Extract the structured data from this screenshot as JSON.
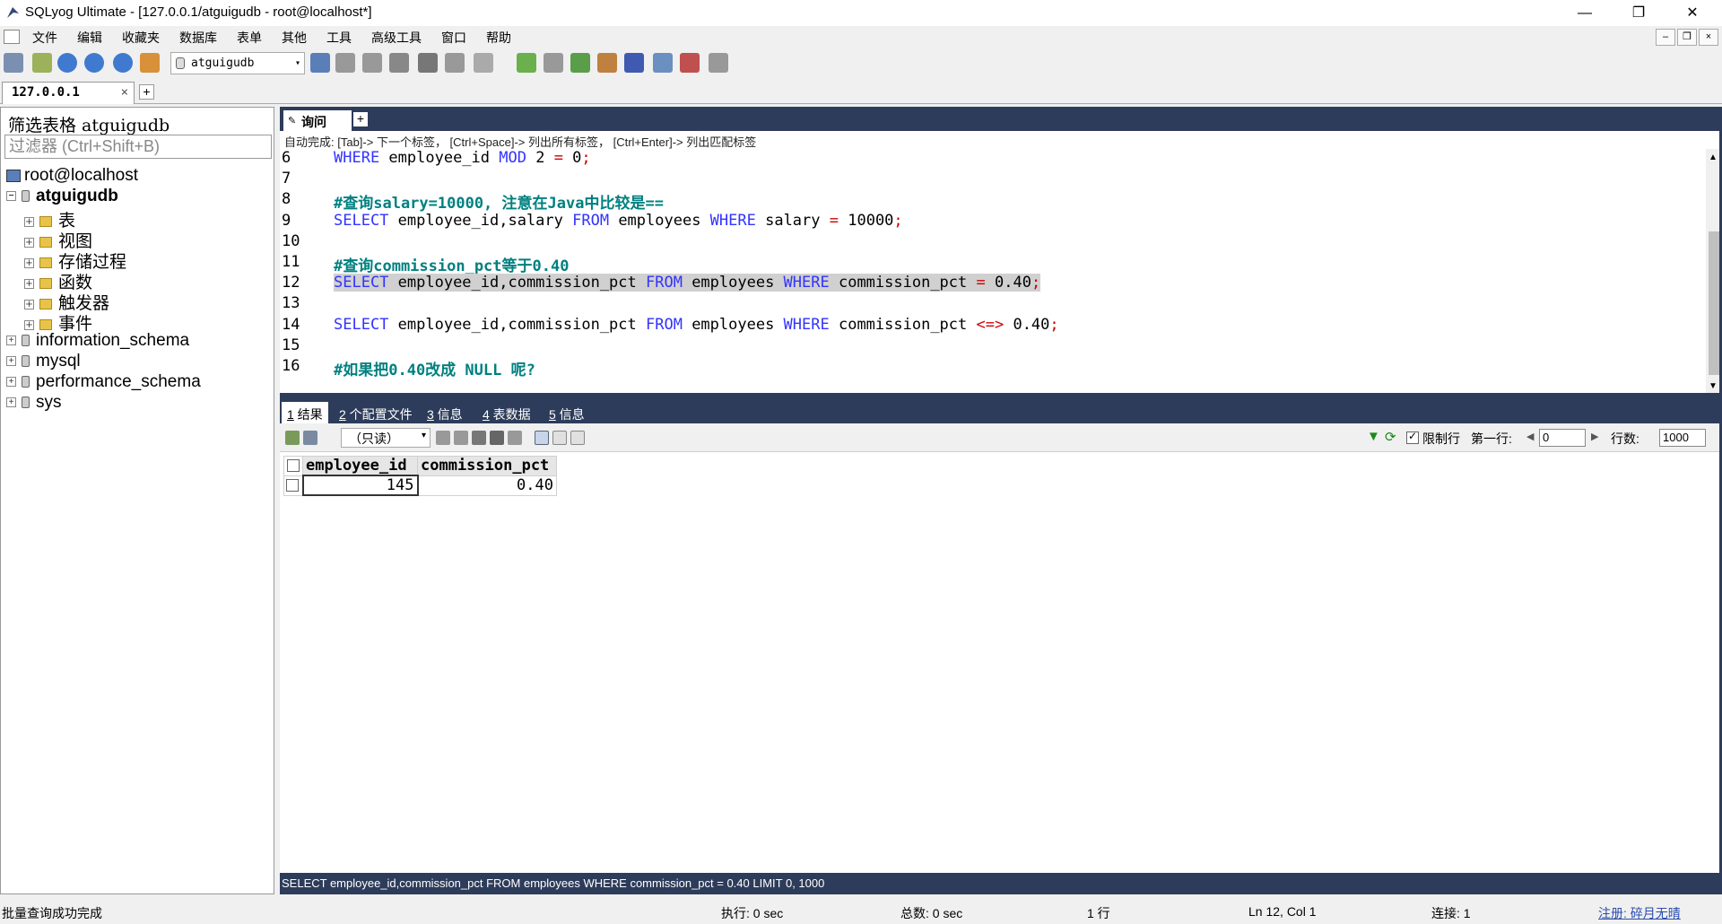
{
  "window": {
    "title": "SQLyog Ultimate - [127.0.0.1/atguigudb - root@localhost*]",
    "controls": {
      "minimize": "—",
      "maximize": "❐",
      "close": "✕"
    }
  },
  "menu": {
    "items": [
      "文件",
      "编辑",
      "收藏夹",
      "数据库",
      "表单",
      "其他",
      "工具",
      "高级工具",
      "窗口",
      "帮助"
    ],
    "mdi_controls": [
      "–",
      "❐",
      "×"
    ]
  },
  "toolbar": {
    "db_selector": "atguigudb",
    "arrow": "▾"
  },
  "connection_tab": {
    "label": "127.0.0.1",
    "close": "×",
    "add": "+"
  },
  "object_browser": {
    "filter_label": "筛选表格 atguigudb",
    "filter_placeholder": "过滤器 (Ctrl+Shift+B)",
    "expander_plus": "+",
    "expander_minus": "−",
    "root": "root@localhost",
    "databases": [
      {
        "name": "atguigudb",
        "expanded": true,
        "children": [
          "表",
          "视图",
          "存储过程",
          "函数",
          "触发器",
          "事件"
        ]
      },
      {
        "name": "information_schema"
      },
      {
        "name": "mysql"
      },
      {
        "name": "performance_schema"
      },
      {
        "name": "sys"
      }
    ]
  },
  "query_tab": {
    "label": "询问",
    "icon": "✎",
    "add": "+"
  },
  "autocomplete_hint": "自动完成: [Tab]-> 下一个标签， [Ctrl+Space]-> 列出所有标签， [Ctrl+Enter]-> 列出匹配标签",
  "editor": {
    "scroll_up": "▲",
    "scroll_down": "▼",
    "lines": [
      {
        "no": "6",
        "tokens": [
          [
            "kw",
            "WHERE"
          ],
          [
            "t",
            " employee_id "
          ],
          [
            "kw",
            "MOD"
          ],
          [
            "t",
            " 2 "
          ],
          [
            "op",
            "="
          ],
          [
            "t",
            " 0"
          ],
          [
            "op",
            ";"
          ]
        ]
      },
      {
        "no": "7",
        "tokens": []
      },
      {
        "no": "8",
        "tokens": [
          [
            "cmt",
            "#查询salary=10000, 注意在Java中比较是=="
          ]
        ]
      },
      {
        "no": "9",
        "tokens": [
          [
            "kw",
            "SELECT"
          ],
          [
            "t",
            " employee_id,salary "
          ],
          [
            "kw",
            "FROM"
          ],
          [
            "t",
            " employees "
          ],
          [
            "kw",
            "WHERE"
          ],
          [
            "t",
            " salary "
          ],
          [
            "op",
            "="
          ],
          [
            "t",
            " 10000"
          ],
          [
            "op",
            ";"
          ]
        ]
      },
      {
        "no": "10",
        "tokens": []
      },
      {
        "no": "11",
        "tokens": [
          [
            "cmt",
            "#查询commission_pct等于0.40"
          ]
        ]
      },
      {
        "no": "12",
        "highlight": true,
        "tokens": [
          [
            "kw",
            "SELECT"
          ],
          [
            "t",
            " employee_id,commission_pct "
          ],
          [
            "kw",
            "FROM"
          ],
          [
            "t",
            " employees "
          ],
          [
            "kw",
            "WHERE"
          ],
          [
            "t",
            " commission_pct "
          ],
          [
            "op",
            "="
          ],
          [
            "t",
            " 0.40"
          ],
          [
            "op",
            ";"
          ]
        ]
      },
      {
        "no": "13",
        "tokens": []
      },
      {
        "no": "14",
        "tokens": [
          [
            "kw",
            "SELECT"
          ],
          [
            "t",
            " employee_id,commission_pct "
          ],
          [
            "kw",
            "FROM"
          ],
          [
            "t",
            " employees "
          ],
          [
            "kw",
            "WHERE"
          ],
          [
            "t",
            " commission_pct "
          ],
          [
            "op",
            "<=>"
          ],
          [
            "t",
            " 0.40"
          ],
          [
            "op",
            ";"
          ]
        ]
      },
      {
        "no": "15",
        "tokens": []
      },
      {
        "no": "16",
        "tokens": [
          [
            "cmt",
            "#如果把0.40改成 NULL 呢?"
          ]
        ]
      }
    ]
  },
  "result_tabs": [
    {
      "num": "1",
      "label": " 结果",
      "active": true
    },
    {
      "num": "2",
      "label": " 个配置文件"
    },
    {
      "num": "3",
      "label": " 信息"
    },
    {
      "num": "4",
      "label": " 表数据"
    },
    {
      "num": "5",
      "label": " 信息"
    }
  ],
  "result_toolbar": {
    "mode": "（只读）",
    "arrow": "▾",
    "limit_label": "限制行",
    "first_row_label": "第一行:",
    "first_row_value": "0",
    "rows_label": "行数:",
    "rows_value": "1000",
    "prev": "◀",
    "next": "▶",
    "filter_icon": "▼",
    "refresh_icon": "⟳"
  },
  "result_grid": {
    "columns": [
      "employee_id",
      "commission_pct"
    ],
    "rows": [
      [
        "145",
        "0.40"
      ]
    ]
  },
  "executed_sql": "SELECT employee_id,commission_pct FROM employees WHERE commission_pct = 0.40 LIMIT 0, 1000",
  "status": {
    "message": "批量查询成功完成",
    "exec": "执行: 0 sec",
    "total": "总数: 0 sec",
    "rows": "1 行",
    "position": "Ln 12, Col 1",
    "connections": "连接: 1",
    "register": "注册: 碎月无晴"
  },
  "colors": {
    "navy": "#2d3c5a",
    "keyword": "#3333ff",
    "operator": "#cc0000",
    "comment": "#008080"
  }
}
